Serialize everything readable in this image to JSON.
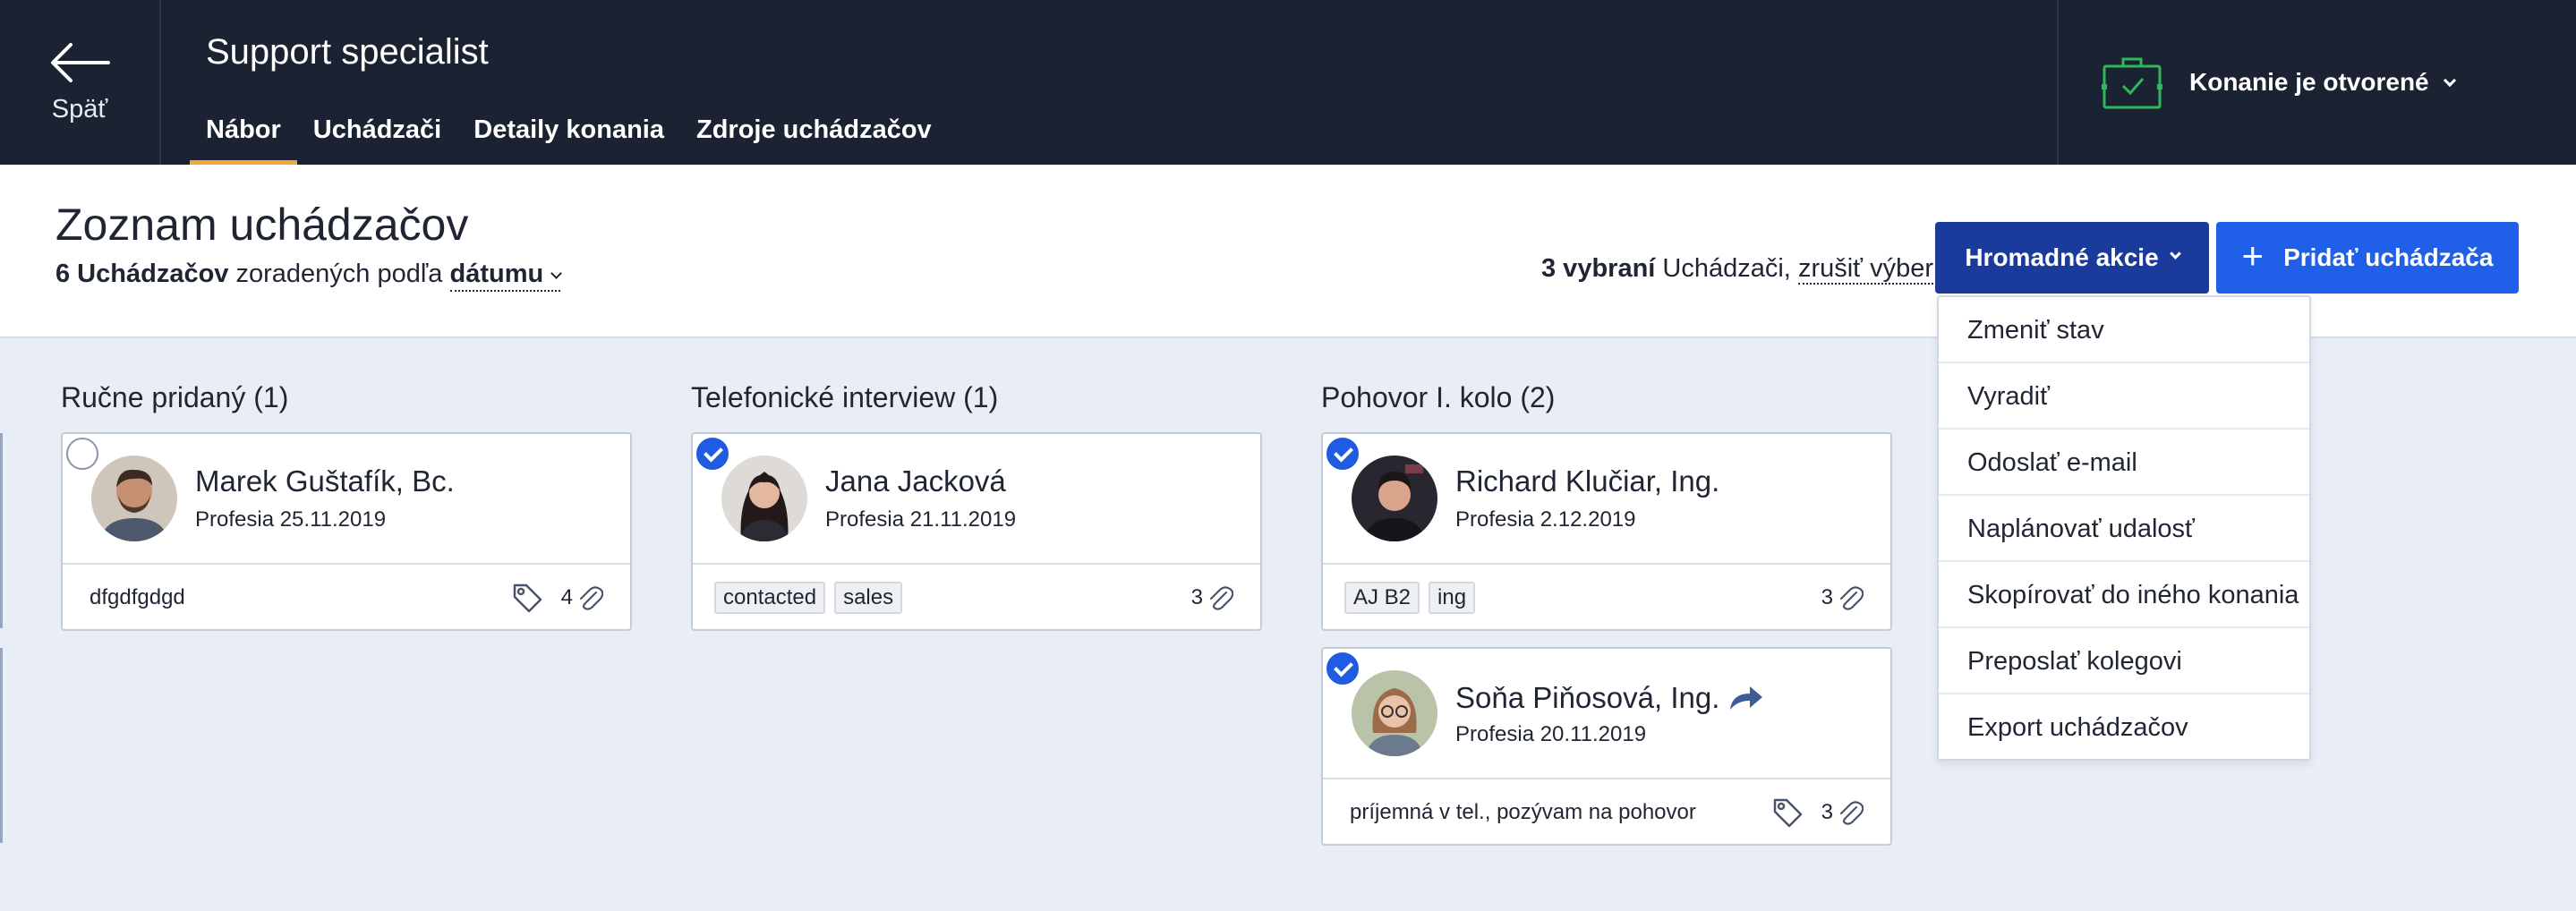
{
  "topbar": {
    "back_label": "Späť",
    "job_title": "Support specialist",
    "tabs": [
      {
        "label": "Nábor",
        "active": true
      },
      {
        "label": "Uchádzači",
        "active": false
      },
      {
        "label": "Detaily konania",
        "active": false
      },
      {
        "label": "Zdroje uchádzačov",
        "active": false
      }
    ],
    "status_label": "Konanie je otvorené",
    "status_icon": "briefcase-check-icon",
    "status_color": "#2fb85a",
    "tab_accent": "#f0a83a"
  },
  "header": {
    "title": "Zoznam uchádzačov",
    "count": "6 Uchádzačov",
    "sort_text": "zoradených podľa",
    "sort_value": "dátumu",
    "selected_count": "3 vybraní",
    "selected_suffix": "Uchádzači,",
    "cancel_selection": "zrušiť výber",
    "bulk_button": "Hromadné akcie",
    "add_button": "Pridať uchádzača",
    "bulk_color": "#1a3b9c",
    "add_color": "#2060e8"
  },
  "bulk_menu": [
    "Zmeniť stav",
    "Vyradiť",
    "Odoslať e-mail",
    "Naplánovať udalosť",
    "Skopírovať do iného konania",
    "Preposlať kolegovi",
    "Export uchádzačov"
  ],
  "columns": [
    {
      "title": "Ručne pridaný (1)",
      "cards": [
        {
          "name": "Marek Guštafík, Bc.",
          "source": "Profesia 25.11.2019",
          "checked": false,
          "note": "dfgdfgdgd",
          "tags": [],
          "has_tag_icon": true,
          "attachments": "4"
        }
      ]
    },
    {
      "title": "Telefonické interview (1)",
      "cards": [
        {
          "name": "Jana Jacková",
          "source": "Profesia 21.11.2019",
          "checked": true,
          "note": "",
          "tags": [
            "contacted",
            "sales"
          ],
          "has_tag_icon": false,
          "attachments": "3"
        }
      ]
    },
    {
      "title": "Pohovor I. kolo (2)",
      "cards": [
        {
          "name": "Richard Klučiar, Ing.",
          "source": "Profesia 2.12.2019",
          "checked": true,
          "note": "",
          "tags": [
            "AJ B2",
            "ing"
          ],
          "has_tag_icon": false,
          "attachments": "3"
        },
        {
          "name": "Soňa Piňosová, Ing.",
          "source": "Profesia 20.11.2019",
          "checked": true,
          "note": "príjemná v tel., pozývam na pohovor",
          "tags": [],
          "has_tag_icon": true,
          "attachments": "3",
          "forwarded": true
        }
      ]
    }
  ]
}
